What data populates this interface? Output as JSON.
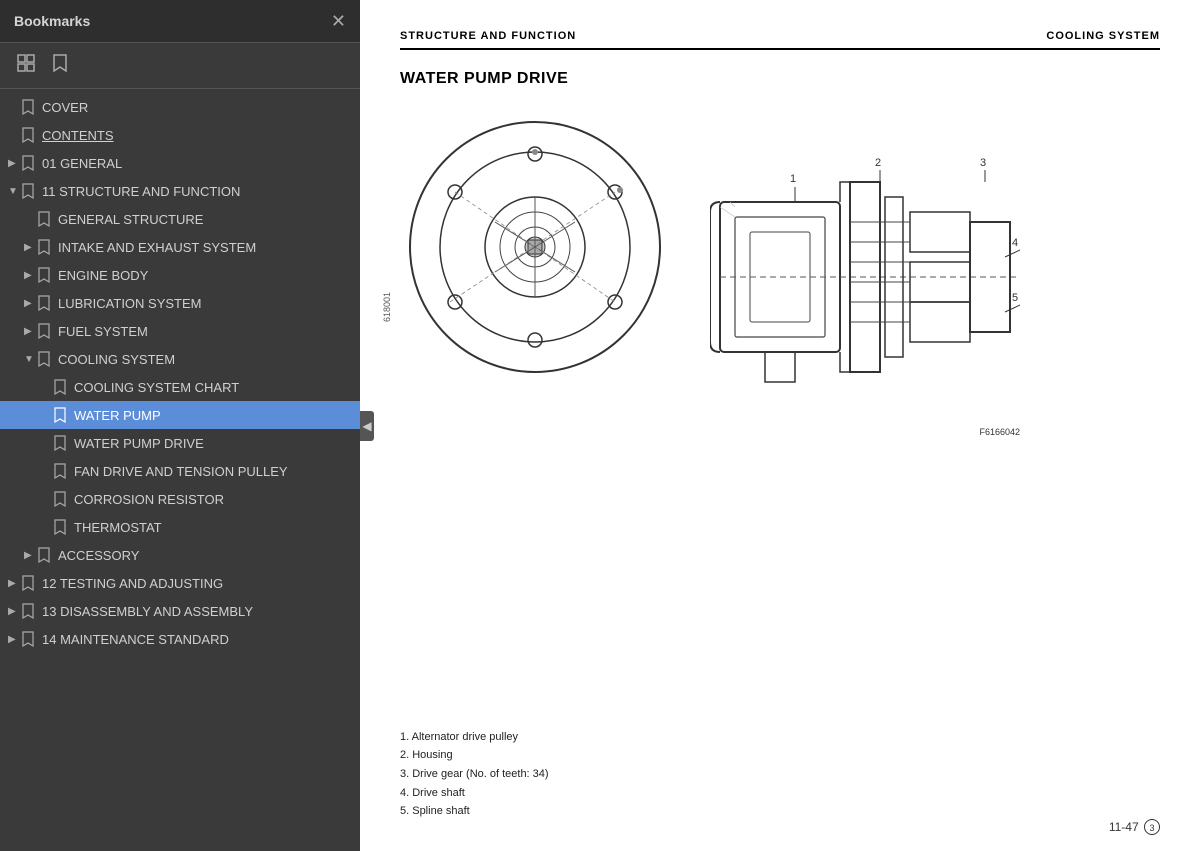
{
  "sidebar": {
    "title": "Bookmarks",
    "items": [
      {
        "id": "cover",
        "label": "COVER",
        "level": 0,
        "indent": 0,
        "expandable": false,
        "expanded": false,
        "active": false,
        "underline": false
      },
      {
        "id": "contents",
        "label": "CONTENTS",
        "level": 0,
        "indent": 0,
        "expandable": false,
        "expanded": false,
        "active": false,
        "underline": true
      },
      {
        "id": "01-general",
        "label": "01 GENERAL",
        "level": 0,
        "indent": 0,
        "expandable": true,
        "expanded": false,
        "active": false,
        "underline": false
      },
      {
        "id": "11-structure",
        "label": "11 STRUCTURE AND FUNCTION",
        "level": 0,
        "indent": 0,
        "expandable": true,
        "expanded": true,
        "active": false,
        "underline": false
      },
      {
        "id": "general-structure",
        "label": "GENERAL STRUCTURE",
        "level": 1,
        "indent": 1,
        "expandable": false,
        "expanded": false,
        "active": false,
        "underline": false
      },
      {
        "id": "intake-exhaust",
        "label": "INTAKE AND EXHAUST SYSTEM",
        "level": 1,
        "indent": 1,
        "expandable": true,
        "expanded": false,
        "active": false,
        "underline": false
      },
      {
        "id": "engine-body",
        "label": "ENGINE BODY",
        "level": 1,
        "indent": 1,
        "expandable": true,
        "expanded": false,
        "active": false,
        "underline": false
      },
      {
        "id": "lubrication",
        "label": "LUBRICATION SYSTEM",
        "level": 1,
        "indent": 1,
        "expandable": true,
        "expanded": false,
        "active": false,
        "underline": false
      },
      {
        "id": "fuel-system",
        "label": "FUEL SYSTEM",
        "level": 1,
        "indent": 1,
        "expandable": true,
        "expanded": false,
        "active": false,
        "underline": false
      },
      {
        "id": "cooling-system",
        "label": "COOLING SYSTEM",
        "level": 1,
        "indent": 1,
        "expandable": true,
        "expanded": true,
        "active": false,
        "underline": false
      },
      {
        "id": "cooling-chart",
        "label": "COOLING SYSTEM CHART",
        "level": 2,
        "indent": 2,
        "expandable": false,
        "expanded": false,
        "active": false,
        "underline": false
      },
      {
        "id": "water-pump",
        "label": "WATER PUMP",
        "level": 2,
        "indent": 2,
        "expandable": false,
        "expanded": false,
        "active": true,
        "underline": false
      },
      {
        "id": "water-pump-drive",
        "label": "WATER PUMP DRIVE",
        "level": 2,
        "indent": 2,
        "expandable": false,
        "expanded": false,
        "active": false,
        "underline": false
      },
      {
        "id": "fan-drive",
        "label": "FAN DRIVE AND TENSION PULLEY",
        "level": 2,
        "indent": 2,
        "expandable": false,
        "expanded": false,
        "active": false,
        "underline": false
      },
      {
        "id": "corrosion",
        "label": "CORROSION RESISTOR",
        "level": 2,
        "indent": 2,
        "expandable": false,
        "expanded": false,
        "active": false,
        "underline": false
      },
      {
        "id": "thermostat",
        "label": "THERMOSTAT",
        "level": 2,
        "indent": 2,
        "expandable": false,
        "expanded": false,
        "active": false,
        "underline": false
      },
      {
        "id": "accessory",
        "label": "ACCESSORY",
        "level": 1,
        "indent": 1,
        "expandable": true,
        "expanded": false,
        "active": false,
        "underline": false
      },
      {
        "id": "12-testing",
        "label": "12 TESTING AND ADJUSTING",
        "level": 0,
        "indent": 0,
        "expandable": true,
        "expanded": false,
        "active": false,
        "underline": false
      },
      {
        "id": "13-disassembly",
        "label": "13 DISASSEMBLY AND ASSEMBLY",
        "level": 0,
        "indent": 0,
        "expandable": true,
        "expanded": false,
        "active": false,
        "underline": false
      },
      {
        "id": "14-maintenance",
        "label": "14 MAINTENANCE STANDARD",
        "level": 0,
        "indent": 0,
        "expandable": true,
        "expanded": false,
        "active": false,
        "underline": false
      }
    ]
  },
  "doc": {
    "header_left": "STRUCTURE AND FUNCTION",
    "header_right": "COOLING SYSTEM",
    "section_title": "WATER PUMP DRIVE",
    "fig_label_left": "618001",
    "fig_label_right": "F6166042",
    "legend": [
      "1.   Alternator drive pulley",
      "2.   Housing",
      "3.   Drive gear (No. of teeth: 34)",
      "4.   Drive shaft",
      "5.   Spline shaft"
    ],
    "page_number": "11-47",
    "page_circle": "3"
  }
}
